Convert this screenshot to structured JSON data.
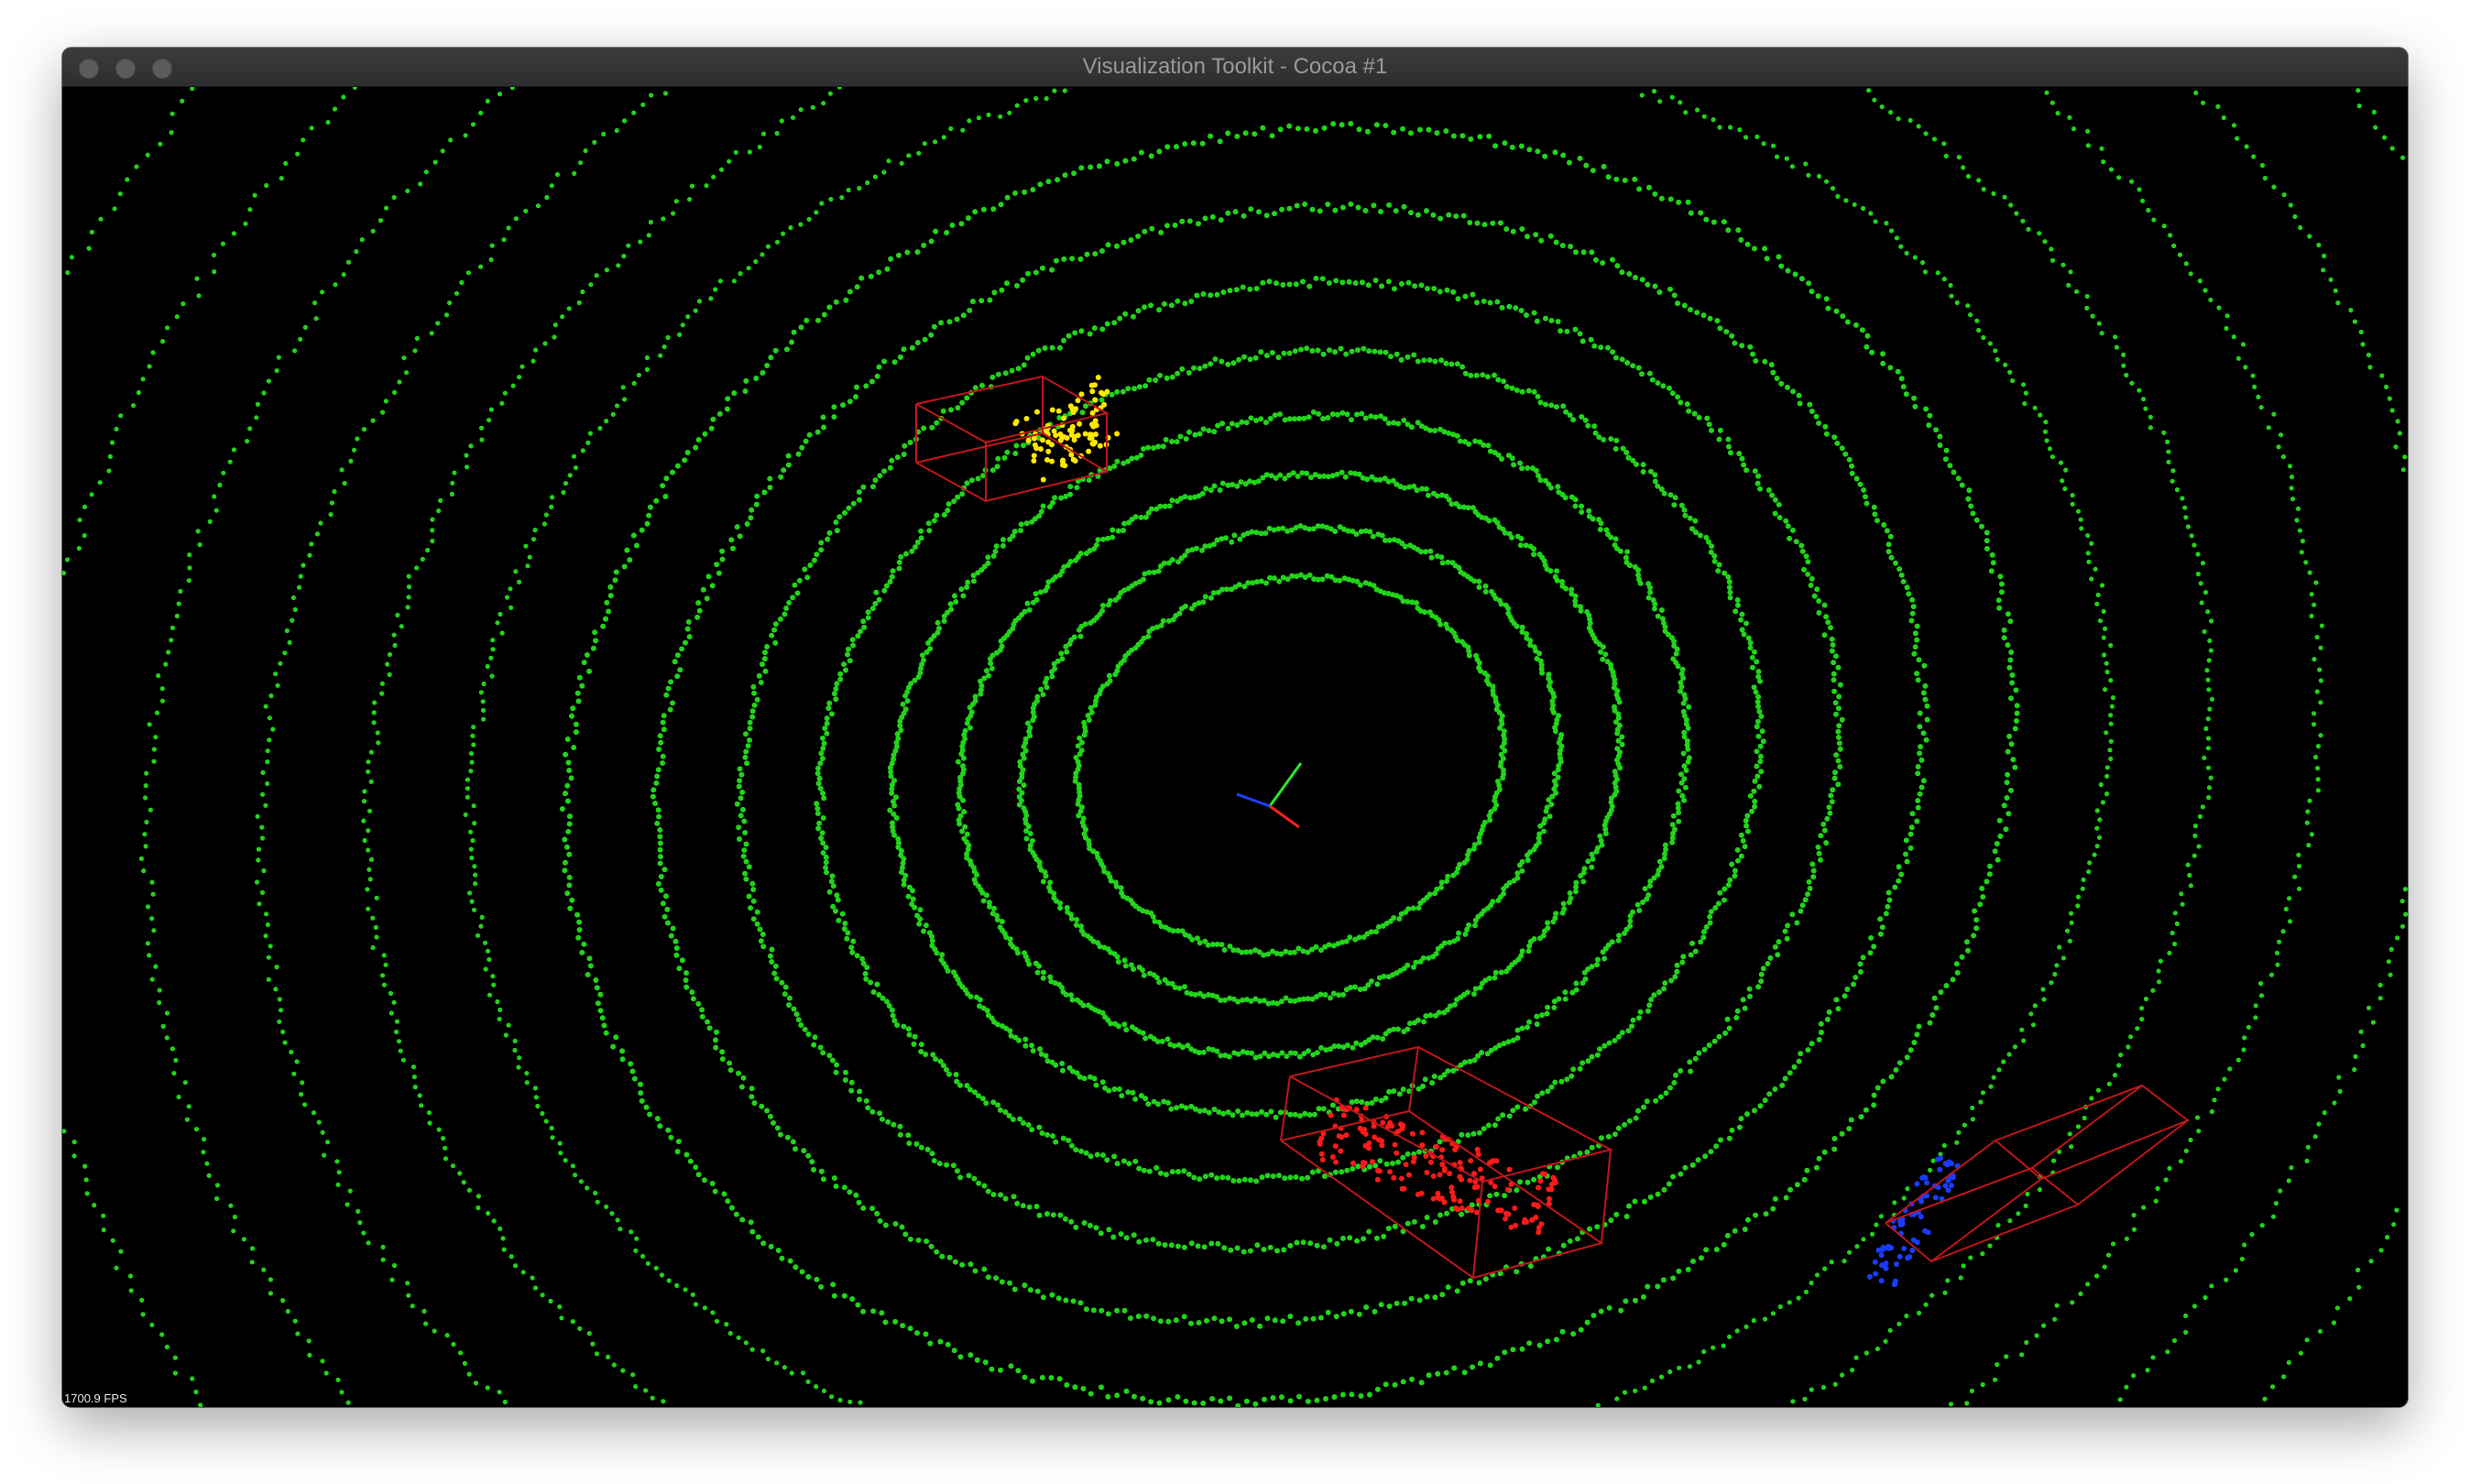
{
  "window": {
    "title": "Visualization Toolkit - Cocoa #1",
    "controls": [
      "close-button",
      "minimize-button",
      "zoom-button"
    ]
  },
  "viewport": {
    "fps_text": "1700.9 FPS",
    "background": "#000000",
    "point_color": "#22d41a",
    "clusters": [
      {
        "name": "yellow-cluster",
        "color": "#ffe800"
      },
      {
        "name": "red-cluster",
        "color": "#ff1a1a"
      },
      {
        "name": "blue-cluster",
        "color": "#1a3cff"
      }
    ],
    "bbox_color": "#c0161c",
    "axes": {
      "x_color": "#ff2020",
      "y_color": "#2ee82e",
      "z_color": "#2040ff"
    }
  }
}
